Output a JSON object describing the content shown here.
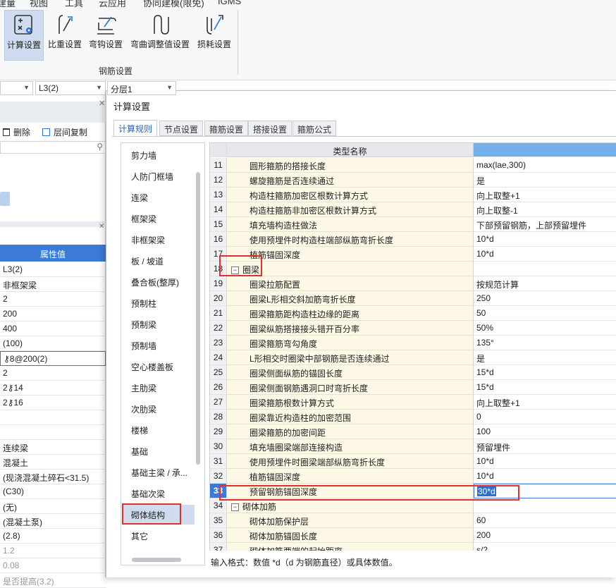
{
  "menu": [
    "建量",
    "视图",
    "工具",
    "云应用",
    "协同建模(限免)",
    "IGMS"
  ],
  "ribbon": {
    "buttons": [
      {
        "label": "计算设置",
        "active": true
      },
      {
        "label": "比重设置"
      },
      {
        "label": "弯钩设置"
      },
      {
        "label": "弯曲调整值设置"
      },
      {
        "label": "损耗设置"
      }
    ],
    "group_label": "钢筋设置"
  },
  "left_panel": {
    "combo1": "",
    "combo2": "L3(2)",
    "combo3": "分层1",
    "toolbar": {
      "delete": "删除",
      "copy": "层间复制"
    },
    "prop_header": "属性值",
    "prop_values": [
      "L3(2)",
      "非框架梁",
      "2",
      "200",
      "400",
      "(100)",
      "⚷8@200(2)",
      "2",
      "2⚷14",
      "2⚷16",
      "",
      "",
      "连续梁",
      "混凝土",
      "(现浇混凝土碎石<31.5)",
      "(C30)",
      "(无)",
      "(混凝土泵)",
      "(2.8)",
      "1.2",
      "0.08",
      "是否提高(3.2)"
    ]
  },
  "dialog": {
    "title": "计算设置",
    "tabs": [
      "计算规则",
      "节点设置",
      "箍筋设置",
      "搭接设置",
      "箍筋公式"
    ],
    "categories": [
      "剪力墙",
      "人防门框墙",
      "连梁",
      "框架梁",
      "非框架梁",
      "板 / 坡道",
      "叠合板(整厚)",
      "预制柱",
      "预制梁",
      "预制墙",
      "空心楼盖板",
      "主肋梁",
      "次肋梁",
      "楼梯",
      "基础",
      "基础主梁 / 承...",
      "基础次梁",
      "砌体结构",
      "其它"
    ],
    "active_category": "砌体结构",
    "grid_header": "类型名称",
    "rows": [
      {
        "n": "11",
        "name": "圆形箍筋的搭接长度",
        "value": "max(lae,300)"
      },
      {
        "n": "12",
        "name": "螺旋箍筋是否连续通过",
        "value": "是"
      },
      {
        "n": "13",
        "name": "构造柱箍筋加密区根数计算方式",
        "value": "向上取整+1"
      },
      {
        "n": "14",
        "name": "构造柱箍筋非加密区根数计算方式",
        "value": "向上取整-1"
      },
      {
        "n": "15",
        "name": "填充墙构造柱做法",
        "value": "下部预留钢筋，上部预留埋件"
      },
      {
        "n": "16",
        "name": "使用预埋件时构造柱端部纵筋弯折长度",
        "value": "10*d"
      },
      {
        "n": "17",
        "name": "植筋锚固深度",
        "value": "10*d"
      },
      {
        "n": "18",
        "name": "圈梁",
        "value": "",
        "group": true
      },
      {
        "n": "19",
        "name": "圈梁拉筋配置",
        "value": "按规范计算"
      },
      {
        "n": "20",
        "name": "圈梁L形相交斜加筋弯折长度",
        "value": "250"
      },
      {
        "n": "21",
        "name": "圈梁箍筋距构造柱边缘的距离",
        "value": "50"
      },
      {
        "n": "22",
        "name": "圈梁纵筋搭接接头错开百分率",
        "value": "50%"
      },
      {
        "n": "23",
        "name": "圈梁箍筋弯勾角度",
        "value": "135°"
      },
      {
        "n": "24",
        "name": "L形相交时圈梁中部钢筋是否连续通过",
        "value": "是"
      },
      {
        "n": "25",
        "name": "圈梁侧面纵筋的锚固长度",
        "value": "15*d"
      },
      {
        "n": "26",
        "name": "圈梁侧面钢筋遇洞口时弯折长度",
        "value": "15*d"
      },
      {
        "n": "27",
        "name": "圈梁箍筋根数计算方式",
        "value": "向上取整+1"
      },
      {
        "n": "28",
        "name": "圈梁靠近构造柱的加密范围",
        "value": "0"
      },
      {
        "n": "29",
        "name": "圈梁箍筋的加密间距",
        "value": "100"
      },
      {
        "n": "30",
        "name": "填充墙圈梁端部连接构造",
        "value": "预留埋件"
      },
      {
        "n": "31",
        "name": "使用预埋件时圈梁端部纵筋弯折长度",
        "value": "10*d"
      },
      {
        "n": "32",
        "name": "植筋锚固深度",
        "value": "10*d"
      },
      {
        "n": "33",
        "name": "预留钢筋锚固深度",
        "value": "30*d",
        "selected": true
      },
      {
        "n": "34",
        "name": "砌体加筋",
        "value": "",
        "group": true
      },
      {
        "n": "35",
        "name": "砌体加筋保护层",
        "value": "60"
      },
      {
        "n": "36",
        "name": "砌体加筋锚固长度",
        "value": "200"
      },
      {
        "n": "37",
        "name": "砌体加筋两端的起始距离",
        "value": "s/2"
      }
    ],
    "hint": "输入格式：数值 *d（d 为钢筋直径）或具体数值。"
  }
}
